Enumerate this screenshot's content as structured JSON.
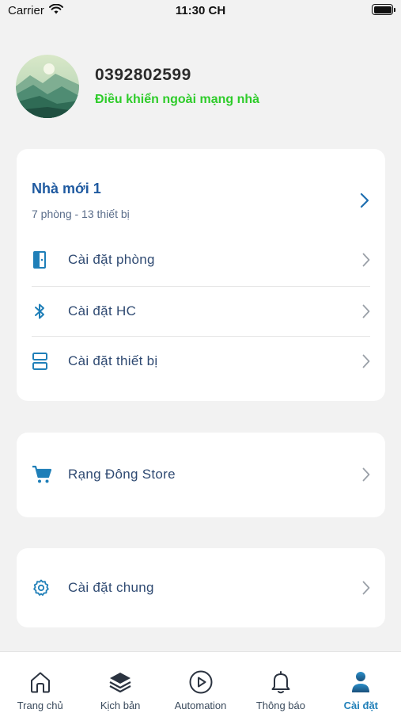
{
  "status_bar": {
    "carrier": "Carrier",
    "time": "11:30 CH"
  },
  "profile": {
    "phone": "0392802599",
    "remote_status": "Điều khiển ngoài mạng nhà",
    "remote_status_color": "#2ecc2a"
  },
  "home": {
    "name": "Nhà mới 1",
    "summary": "7 phòng - 13 thiết bị",
    "menu": [
      {
        "label": "Cài đặt phòng",
        "icon": "door-icon"
      },
      {
        "label": "Cài đặt HC",
        "icon": "bluetooth-icon"
      },
      {
        "label": "Cài đặt thiết bị",
        "icon": "device-icon"
      }
    ]
  },
  "store": {
    "label": "Rạng Đông Store",
    "icon": "cart-icon"
  },
  "general": {
    "label": "Cài đặt chung",
    "icon": "gear-icon"
  },
  "tabs": [
    {
      "label": "Trang chủ",
      "icon": "home-icon",
      "active": false
    },
    {
      "label": "Kịch bản",
      "icon": "layers-icon",
      "active": false
    },
    {
      "label": "Automation",
      "icon": "play-circle-icon",
      "active": false
    },
    {
      "label": "Thông báo",
      "icon": "bell-icon",
      "active": false
    },
    {
      "label": "Cài đặt",
      "icon": "user-icon",
      "active": true
    }
  ],
  "colors": {
    "accent": "#1f7fb8",
    "title_blue": "#1f5aa0",
    "background": "#f2f2f2"
  }
}
